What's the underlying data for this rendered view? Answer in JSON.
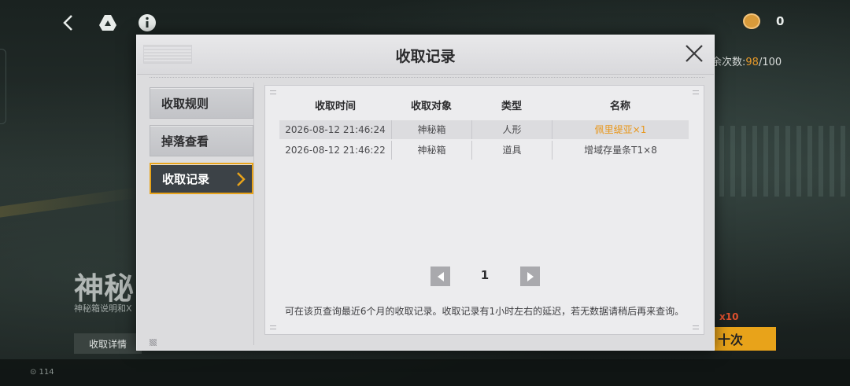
{
  "background": {
    "coin_count": "0",
    "remaining_label": "余次数:",
    "remaining_used": "98",
    "remaining_total": "/100",
    "title": "神秘",
    "subtitle": "神秘箱说明和X",
    "detail_button": "收取详情",
    "x10_label": "x10",
    "ten_button": "十次",
    "bottom_left_text": "⊙ 114"
  },
  "modal": {
    "title": "收取记录",
    "nav": [
      {
        "label": "收取规则"
      },
      {
        "label": "掉落查看"
      },
      {
        "label": "收取记录"
      }
    ],
    "table": {
      "headers": [
        "收取时间",
        "收取对象",
        "类型",
        "名称"
      ],
      "rows": [
        {
          "time": "2026-08-12 21:46:24",
          "target": "神秘箱",
          "type": "人形",
          "name": "佩里缇亚×1"
        },
        {
          "time": "2026-08-12 21:46:22",
          "target": "神秘箱",
          "type": "道具",
          "name": "增域存量条T1×8"
        }
      ]
    },
    "pagination": {
      "current_page": "1"
    },
    "hint": "可在该页查询最近6个月的收取记录。收取记录有1小时左右的延迟，若无数据请稍后再来查询。"
  },
  "colors": {
    "accent": "#e8a31a",
    "highlight_name": "#e8961a",
    "active_nav_bg": "#3c4247"
  },
  "icons": [
    "back-icon",
    "drive-icon",
    "info-icon",
    "coin-icon",
    "close-icon",
    "chevron-right-icon",
    "page-prev-icon",
    "page-next-icon"
  ]
}
